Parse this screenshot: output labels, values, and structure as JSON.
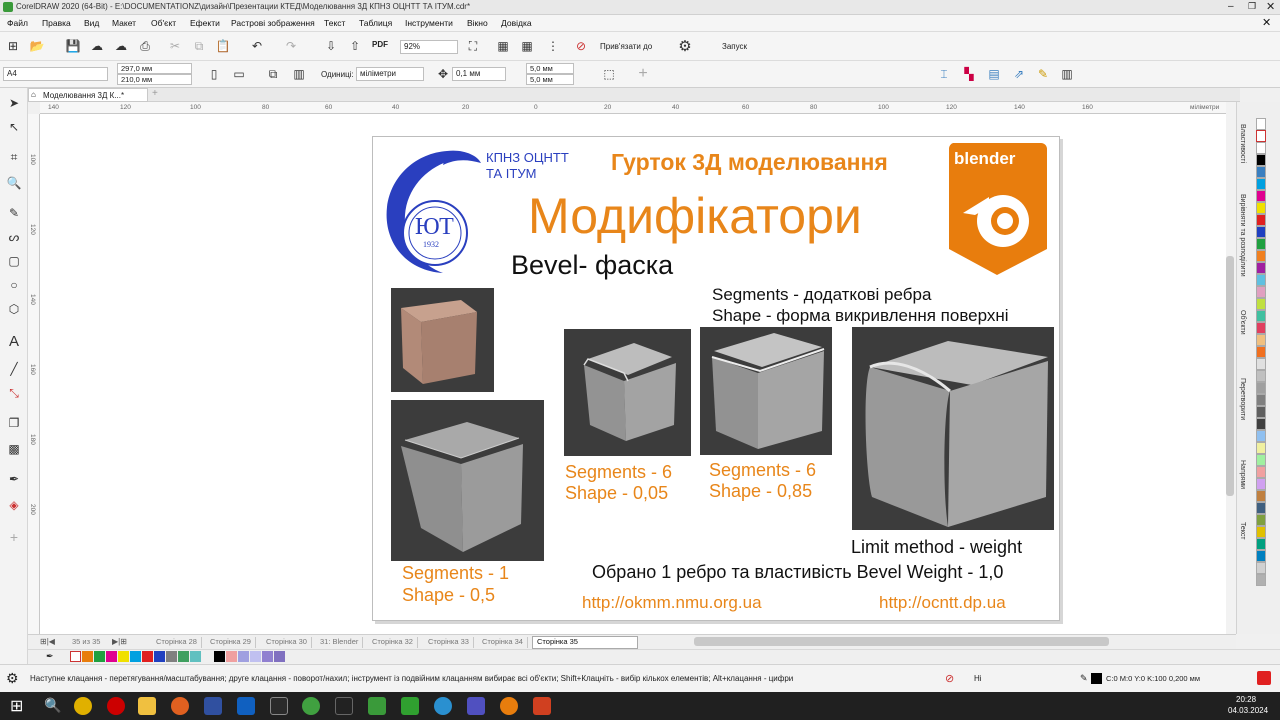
{
  "window": {
    "title": "CorelDRAW 2020 (64-Bit) - E:\\DOCUMENTATIONZ\\дизайн\\Презентации КТЕД\\Моделювання 3Д КПНЗ ОЦНТТ ТА ІТУМ.cdr*"
  },
  "menu": [
    "Файл",
    "Правка",
    "Вид",
    "Макет",
    "Об'єкт",
    "Ефекти",
    "Растрові зображення",
    "Текст",
    "Таблиця",
    "Інструменти",
    "Вікно",
    "Довідка"
  ],
  "toolbar": {
    "pdf_label": "PDF",
    "zoom": "92%",
    "snap_label": "Прив'язати до",
    "launch_label": "Запуск"
  },
  "propbar": {
    "page_size": "A4",
    "width": "297,0 мм",
    "height": "210,0 мм",
    "units_label": "Одиниці:",
    "units_value": "міліметри",
    "nudge": "0,1 мм",
    "dup_x": "5,0 мм",
    "dup_y": "5,0 мм"
  },
  "doc_tab": "Моделювання 3Д К...*",
  "ruler": {
    "h_ticks": [
      "140",
      "120",
      "100",
      "80",
      "60",
      "40",
      "20",
      "0",
      "20",
      "40",
      "60",
      "80",
      "100",
      "120",
      "140",
      "160"
    ],
    "unit": "міліметри",
    "v_ticks": [
      "100",
      "120",
      "140",
      "160",
      "180",
      "200"
    ]
  },
  "dockers": [
    "Властивості",
    "Вирівняти та розподілити",
    "Об'єкти",
    "Перетворити",
    "Напрями",
    "Текст"
  ],
  "slide": {
    "org_line1": "КПНЗ ОЦНТТ",
    "org_line2": "ТА ІТУМ",
    "logo_text": "ЮТ",
    "logo_year": "1932",
    "club": "Гурток 3Д моделювання",
    "title": "Модифікатори",
    "subtitle": "Bevel- фаска",
    "desc1": "Segments - додаткові ребра",
    "desc2": "Shape - форма викривлення поверхні",
    "blender": "blender",
    "cap1_a": "Segments - 1",
    "cap1_b": "Shape - 0,5",
    "cap2_a": "Segments - 6",
    "cap2_b": "Shape - 0,05",
    "cap3_a": "Segments - 6",
    "cap3_b": "Shape - 0,85",
    "limit": "Limit method - weight",
    "selected": "Обрано 1 ребро та властивість Bevel Weight - 1,0",
    "url1": "http://okmm.nmu.org.ua",
    "url2": "http://ocntt.dp.ua"
  },
  "pages": {
    "counter": "35 из 35",
    "tabs": [
      "Сторінка 28",
      "Сторінка 29",
      "Сторінка 30",
      "31: Blender",
      "Сторінка 32",
      "Сторінка 33",
      "Сторінка 34",
      "Сторінка 35"
    ]
  },
  "status": {
    "hint": "Наступне клацання - перетягування/масштабування; друге клацання - поворот/нахил; інструмент із подвійним клацанням вибирає всі об'єкти; Shift+Клацніть - вибір кількох елементів; Alt+клацання - цифри",
    "fill": "Ні",
    "outline": "C:0 M:0 Y:0 K:100  0,200 мм"
  },
  "clock": {
    "time": "20:28",
    "date": "04.03.2024"
  },
  "colors": {
    "accent_orange": "#e8861a",
    "blue": "#2a3fbf",
    "blender_orange": "#e87d0d"
  }
}
